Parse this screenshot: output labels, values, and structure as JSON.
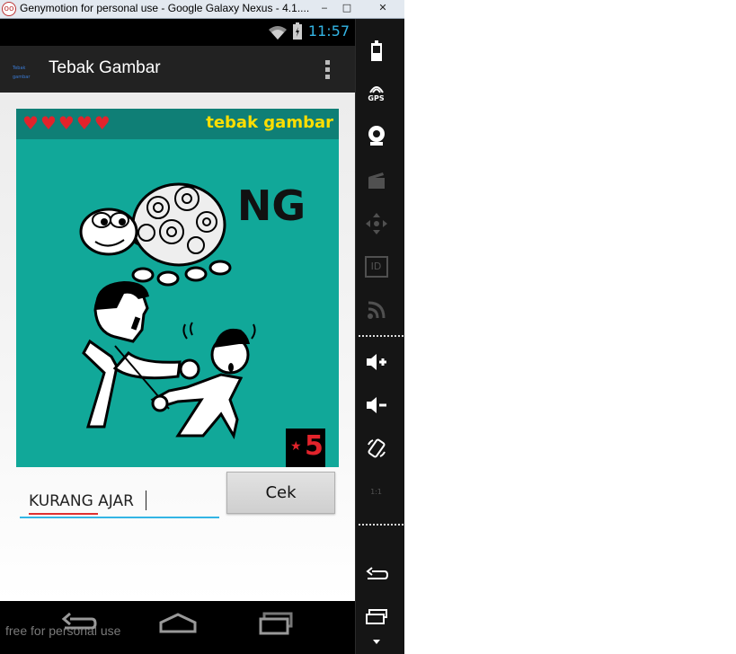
{
  "window": {
    "title": "Genymotion for personal use - Google Galaxy Nexus - 4.1....",
    "minimize": "‒",
    "maximize": "□",
    "close": "✕"
  },
  "status_bar": {
    "time": "11:57"
  },
  "action_bar": {
    "app_icon_text": "Tebak gambar",
    "title": "Tebak Gambar"
  },
  "puzzle": {
    "brand": "tebak gambar",
    "hearts": [
      "♥",
      "♥",
      "♥",
      "♥",
      "♥"
    ],
    "image_text": "NG",
    "level_star": "★",
    "level": "5"
  },
  "answer": {
    "value": "KURANG AJAR",
    "button": "Cek"
  },
  "watermark": "free for personal use",
  "sidebar": {
    "gps_label": "GPS",
    "id_label": "ID",
    "pixel_label": "1:1"
  },
  "colors": {
    "status_accent": "#33b5e5",
    "puzzle_bg": "#11a899",
    "brand": "#ffde00",
    "heart": "#e2232b"
  }
}
